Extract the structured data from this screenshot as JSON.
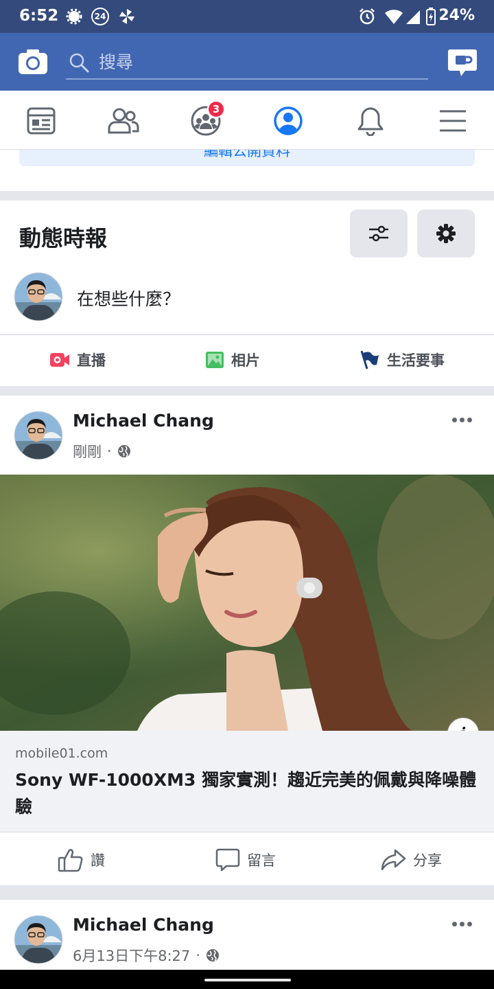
{
  "status_bar": {
    "time": "6:52",
    "notification_badge": "24",
    "battery": "24%"
  },
  "app_bar": {
    "search_placeholder": "搜尋",
    "icons": [
      "camera-icon",
      "search-icon",
      "messenger-icon"
    ]
  },
  "tabs": [
    {
      "name": "news-feed",
      "icon": "news-feed-icon"
    },
    {
      "name": "friends",
      "icon": "friends-icon"
    },
    {
      "name": "groups",
      "icon": "groups-icon",
      "badge": "3"
    },
    {
      "name": "profile",
      "icon": "profile-icon",
      "active": true
    },
    {
      "name": "notifications",
      "icon": "bell-icon"
    },
    {
      "name": "menu",
      "icon": "menu-icon"
    }
  ],
  "partial_card": {
    "button_label": "編輯公開資料"
  },
  "feed_header": {
    "title": "動態時報",
    "composer_prompt": "在想些什麼？",
    "actions": [
      {
        "label": "直播",
        "icon": "live-video-icon",
        "color": "#f3425f"
      },
      {
        "label": "相片",
        "icon": "photo-icon",
        "color": "#45bd62"
      },
      {
        "label": "生活要事",
        "icon": "flag-icon",
        "color": "#1b3e79"
      }
    ]
  },
  "post": {
    "author": "Michael Chang",
    "time": "剛剛",
    "separator": "·",
    "link_domain": "mobile01.com",
    "link_title": "Sony WF-1000XM3 獨家實測！趨近完美的佩戴與降噪體驗",
    "info_label": "i",
    "actions": [
      {
        "label": "讚",
        "icon": "like-icon"
      },
      {
        "label": "留言",
        "icon": "comment-icon"
      },
      {
        "label": "分享",
        "icon": "share-icon"
      }
    ]
  },
  "next_post": {
    "author": "Michael Chang",
    "time": "6月13日下午8:27",
    "separator": "·"
  },
  "colors": {
    "brand": "#4267b2",
    "status_bar": "#344a7c",
    "active_tab": "#1877f2",
    "badge": "#f02849"
  }
}
